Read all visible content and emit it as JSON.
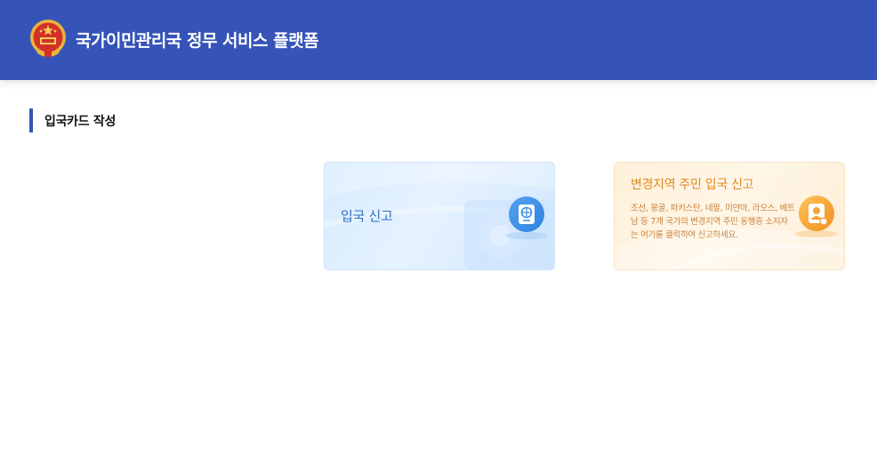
{
  "header": {
    "title": "국가이민관리국 정무 서비스 플랫폼",
    "emblem_icon": "national-emblem-icon",
    "color": "#3654b8"
  },
  "section": {
    "title": "입국카드 작성"
  },
  "cards": {
    "entry": {
      "label": "입국 신고",
      "icon": "passport-icon",
      "color": "#2f6fc0"
    },
    "border_resident": {
      "title": "변경지역 주민 입국 신고",
      "description": "조선, 몽골, 파키스탄, 네팔, 미얀마, 라오스, 베트남 등 7개 국가의 변경지역 주민 동행증 소지자는 여기를 클릭하여 신고하세요.",
      "icon": "id-card-icon",
      "color": "#e08a1c"
    }
  }
}
